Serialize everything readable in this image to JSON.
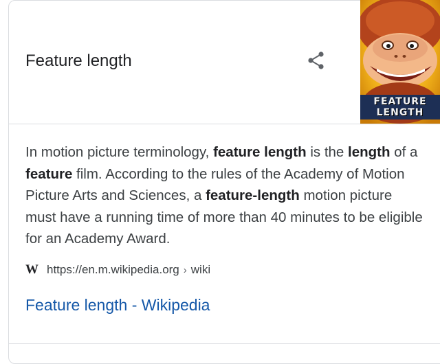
{
  "header": {
    "title": "Feature length"
  },
  "thumbnail": {
    "caption_line1": "FEATURE",
    "caption_line2": "LENGTH"
  },
  "description": {
    "segments": [
      {
        "text": "In motion picture terminology, ",
        "bold": false
      },
      {
        "text": "feature length",
        "bold": true
      },
      {
        "text": " is the ",
        "bold": false
      },
      {
        "text": "length",
        "bold": true
      },
      {
        "text": " of a ",
        "bold": false
      },
      {
        "text": "feature",
        "bold": true
      },
      {
        "text": " film. According to the rules of the Academy of Motion Picture Arts and Sciences, a ",
        "bold": false
      },
      {
        "text": "feature-length",
        "bold": true
      },
      {
        "text": " motion picture must have a running time of more than 40 minutes to be eligible for an Academy Award.",
        "bold": false
      }
    ]
  },
  "source": {
    "icon_glyph": "W",
    "url": "https://en.m.wikipedia.org",
    "separator": "›",
    "path": "wiki"
  },
  "result_link": {
    "label": "Feature length - Wikipedia"
  },
  "colors": {
    "link": "#1558a8",
    "text": "#3c4043",
    "border": "#dadce0"
  }
}
